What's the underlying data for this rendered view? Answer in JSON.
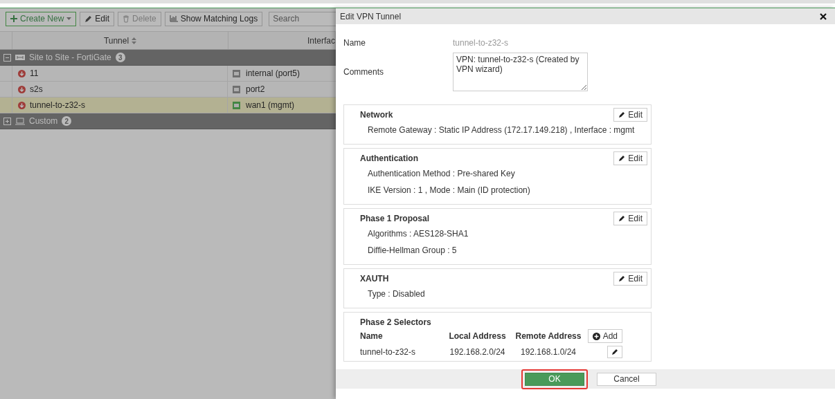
{
  "toolbar": {
    "buttons": [
      {
        "kind": "create",
        "label": "Create New",
        "disabled": false
      },
      {
        "kind": "edit",
        "label": "Edit",
        "disabled": false
      },
      {
        "kind": "delete",
        "label": "Delete",
        "disabled": true
      },
      {
        "kind": "logs",
        "label": "Show Matching Logs",
        "disabled": false
      }
    ],
    "search": {
      "placeholder": "Search"
    }
  },
  "table": {
    "columns": [
      "Tunnel",
      "Interfac"
    ],
    "groups": [
      {
        "kind": "site",
        "label": "Site to Site - FortiGate",
        "count": "3",
        "expanded": true,
        "rows": [
          {
            "tunnel": "11",
            "interface": "internal (port5)",
            "link_up": false,
            "selected": false
          },
          {
            "tunnel": "s2s",
            "interface": "port2",
            "link_up": false,
            "selected": false
          },
          {
            "tunnel": "tunnel-to-z32-s",
            "interface": "wan1 (mgmt)",
            "link_up": true,
            "selected": true
          }
        ]
      },
      {
        "kind": "custom",
        "label": "Custom",
        "count": "2",
        "expanded": false
      }
    ]
  },
  "dialog": {
    "title": "Edit VPN Tunnel",
    "name": {
      "label": "Name",
      "value": "tunnel-to-z32-s"
    },
    "comments": {
      "label": "Comments",
      "value": "VPN: tunnel-to-z32-s (Created by VPN wizard)"
    },
    "sections": [
      {
        "title": "Network",
        "action": "Edit",
        "lines": [
          "Remote Gateway : Static IP Address (172.17.149.218) , Interface : mgmt"
        ]
      },
      {
        "title": "Authentication",
        "action": "Edit",
        "lines": [
          "Authentication Method : Pre-shared Key",
          "IKE Version : 1 , Mode : Main (ID protection)"
        ]
      },
      {
        "title": "Phase 1 Proposal",
        "action": "Edit",
        "lines": [
          "Algorithms : AES128-SHA1",
          "Diffie-Hellman Group : 5"
        ]
      },
      {
        "title": "XAUTH",
        "action": "Edit",
        "lines": [
          "Type : Disabled"
        ]
      }
    ],
    "phase2": {
      "title": "Phase 2 Selectors",
      "columns": [
        "Name",
        "Local Address",
        "Remote Address"
      ],
      "action": "Add",
      "rows": [
        {
          "name": "tunnel-to-z32-s",
          "local": "192.168.2.0/24",
          "remote": "192.168.1.0/24"
        }
      ]
    },
    "footer": [
      {
        "kind": "primary",
        "label": "OK",
        "highlighted": true
      },
      {
        "kind": "secondary",
        "label": "Cancel",
        "highlighted": false
      }
    ]
  }
}
